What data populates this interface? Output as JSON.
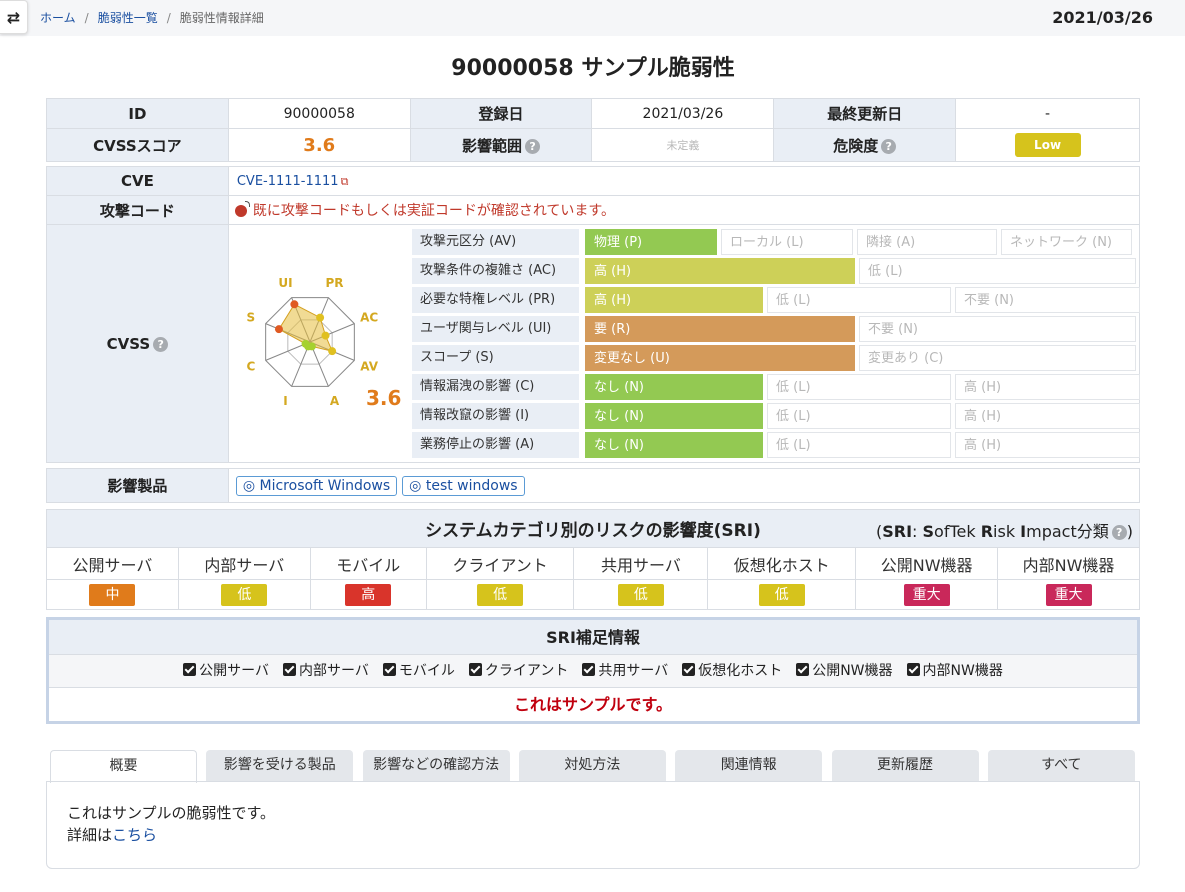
{
  "breadcrumb": {
    "home": "ホーム",
    "list": "脆弱性一覧",
    "current": "脆弱性情報詳細"
  },
  "header": {
    "date": "2021/03/26"
  },
  "title": "90000058 サンプル脆弱性",
  "summary": {
    "id_label": "ID",
    "id_value": "90000058",
    "registered_label": "登録日",
    "registered_value": "2021/03/26",
    "updated_label": "最終更新日",
    "updated_value": "-",
    "cvss_label": "CVSSスコア",
    "cvss_value": "3.6",
    "scope_label": "影響範囲",
    "scope_value": "未定義",
    "risk_label": "危険度",
    "risk_value": "Low"
  },
  "cve": {
    "label": "CVE",
    "link": "CVE-1111-1111"
  },
  "exploit": {
    "label": "攻撃コード",
    "text": "既に攻撃コードもしくは実証コードが確認されています。"
  },
  "cvss": {
    "label": "CVSS",
    "score": "3.6",
    "radar_labels": [
      "PR",
      "AC",
      "AV",
      "A",
      "I",
      "C",
      "S",
      "UI"
    ],
    "radar_values": [
      0.55,
      0.35,
      0.5,
      0.1,
      0.1,
      0.1,
      0.7,
      0.85
    ],
    "metrics": [
      {
        "label": "攻撃元区分 (AV)",
        "options": [
          "物理 (P)",
          "ローカル (L)",
          "隣接 (A)",
          "ネットワーク (N)"
        ],
        "selected": 0,
        "color": "green"
      },
      {
        "label": "攻撃条件の複雑さ (AC)",
        "options": [
          "高 (H)",
          "低 (L)"
        ],
        "selected": 0,
        "color": "yellow"
      },
      {
        "label": "必要な特権レベル (PR)",
        "options": [
          "高 (H)",
          "低 (L)",
          "不要 (N)"
        ],
        "selected": 0,
        "color": "yellow"
      },
      {
        "label": "ユーザ関与レベル (UI)",
        "options": [
          "要 (R)",
          "不要 (N)"
        ],
        "selected": 0,
        "color": "orange"
      },
      {
        "label": "スコープ (S)",
        "options": [
          "変更なし (U)",
          "変更あり (C)"
        ],
        "selected": 0,
        "color": "orange"
      },
      {
        "label": "情報漏洩の影響 (C)",
        "options": [
          "なし (N)",
          "低 (L)",
          "高 (H)"
        ],
        "selected": 0,
        "color": "green"
      },
      {
        "label": "情報改竄の影響 (I)",
        "options": [
          "なし (N)",
          "低 (L)",
          "高 (H)"
        ],
        "selected": 0,
        "color": "green"
      },
      {
        "label": "業務停止の影響 (A)",
        "options": [
          "なし (N)",
          "低 (L)",
          "高 (H)"
        ],
        "selected": 0,
        "color": "green"
      }
    ]
  },
  "products": {
    "label": "影響製品",
    "items": [
      "Microsoft Windows",
      "test windows"
    ]
  },
  "sri": {
    "title": "システムカテゴリ別のリスクの影響度(SRI)",
    "note_prefix": "(",
    "note_s": "SRI",
    "note_mid": ": ",
    "note_s2": "S",
    "note_o": "ofTek ",
    "note_r": "R",
    "note_isk": "isk ",
    "note_i": "I",
    "note_rest": "mpact分類",
    "note_suffix": ")",
    "categories": [
      {
        "name": "公開サーバ",
        "level": "中",
        "color": "#e07b1b"
      },
      {
        "name": "内部サーバ",
        "level": "低",
        "color": "#d6c31c"
      },
      {
        "name": "モバイル",
        "level": "高",
        "color": "#d9342b"
      },
      {
        "name": "クライアント",
        "level": "低",
        "color": "#d6c31c"
      },
      {
        "name": "共用サーバ",
        "level": "低",
        "color": "#d6c31c"
      },
      {
        "name": "仮想化ホスト",
        "level": "低",
        "color": "#d6c31c"
      },
      {
        "name": "公開NW機器",
        "level": "重大",
        "color": "#c9285a"
      },
      {
        "name": "内部NW機器",
        "level": "重大",
        "color": "#c9285a"
      }
    ]
  },
  "sri_sup": {
    "title": "SRI補足情報",
    "checks": [
      "公開サーバ",
      "内部サーバ",
      "モバイル",
      "クライアント",
      "共用サーバ",
      "仮想化ホスト",
      "公開NW機器",
      "内部NW機器"
    ],
    "note": "これはサンプルです。"
  },
  "tabs": [
    "概要",
    "影響を受ける製品",
    "影響などの確認方法",
    "対処方法",
    "関連情報",
    "更新履歴",
    "すべて"
  ],
  "overview": {
    "line1": "これはサンプルの脆弱性です。",
    "line2_prefix": "詳細は",
    "line2_link": "こちら"
  },
  "colors": {
    "accent": "#1a4fa0",
    "label_bg": "#e9eef5",
    "score": "#e07b1b",
    "danger": "#c0392b"
  }
}
